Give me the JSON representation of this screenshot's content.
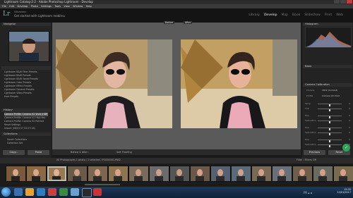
{
  "window": {
    "title": "Lightroom Catalog-2-2 - Adobe Photoshop Lightroom - Develop"
  },
  "menu": [
    "File",
    "Edit",
    "Develop",
    "Photo",
    "Settings",
    "Tools",
    "View",
    "Window",
    "Help"
  ],
  "identity": {
    "logo": "Lr",
    "catalog": "Sébastien",
    "status": "Get started with Lightroom mobile ▸"
  },
  "modules": [
    {
      "label": "Library",
      "active": false
    },
    {
      "label": "Develop",
      "active": true
    },
    {
      "label": "Map",
      "active": false
    },
    {
      "label": "Book",
      "active": false
    },
    {
      "label": "Slideshow",
      "active": false
    },
    {
      "label": "Print",
      "active": false
    },
    {
      "label": "Web",
      "active": false
    }
  ],
  "left_panel": {
    "navigator": "Navigator",
    "presets": [
      "Lightroom B&W Filter Presets",
      "Lightroom B&W Presets",
      "Lightroom B&W Toned Presets",
      "Lightroom Color Presets",
      "Lightroom Effect Presets",
      "Lightroom General Presets",
      "Lightroom Video Presets",
      "User Presets"
    ],
    "history_header": "History",
    "history": [
      "Camera Profile: Camera V2 Vivid (HDR)",
      "Camera Profile: Camera V2 High Key",
      "Camera Profile: Camera V2 Portrait",
      "Reset Settings",
      "Import (08/01/17 22:27:16)"
    ],
    "collections": "Collections",
    "collection_items": [
      "Smart Collections",
      "Collection Set"
    ],
    "copy": "Copy...",
    "paste": "Paste"
  },
  "center": {
    "before": "Before",
    "after": "After",
    "toolbar_text": "Before & After :",
    "sync_text": "Soft Proofing"
  },
  "right_panel": {
    "histogram": "Histogram",
    "basic": "Basic",
    "camera_calibration": "Camera Calibration",
    "process": "Process",
    "process_value": "2012 (Current)",
    "profile": "Profile",
    "profile_value": "Camera V2 Vivid",
    "sliders": [
      {
        "label": "Temp",
        "value": "0",
        "level": 0.5
      },
      {
        "label": "Tint",
        "value": "0",
        "level": 0.5
      },
      {
        "label": "Hue",
        "value": "0",
        "level": 0.5
      },
      {
        "label": "Saturation",
        "value": "0",
        "level": 0.5
      },
      {
        "label": "Hue",
        "value": "0",
        "level": 0.5
      },
      {
        "label": "Saturation",
        "value": "0",
        "level": 0.5
      },
      {
        "label": "Hue",
        "value": "0",
        "level": 0.5
      },
      {
        "label": "Saturation",
        "value": "0",
        "level": 0.5
      }
    ],
    "previous": "Previous",
    "reset": "Reset",
    "sync_icon": "checkmark-icon"
  },
  "filmstrip": {
    "info": "All Photographs  1 photo / 1 selected / P1000001.RW2",
    "filter": "Filter :",
    "filter_value": "Filters Off"
  },
  "taskbar": {
    "time": "19:35",
    "date": "13/01/2017",
    "lang": "FR"
  }
}
